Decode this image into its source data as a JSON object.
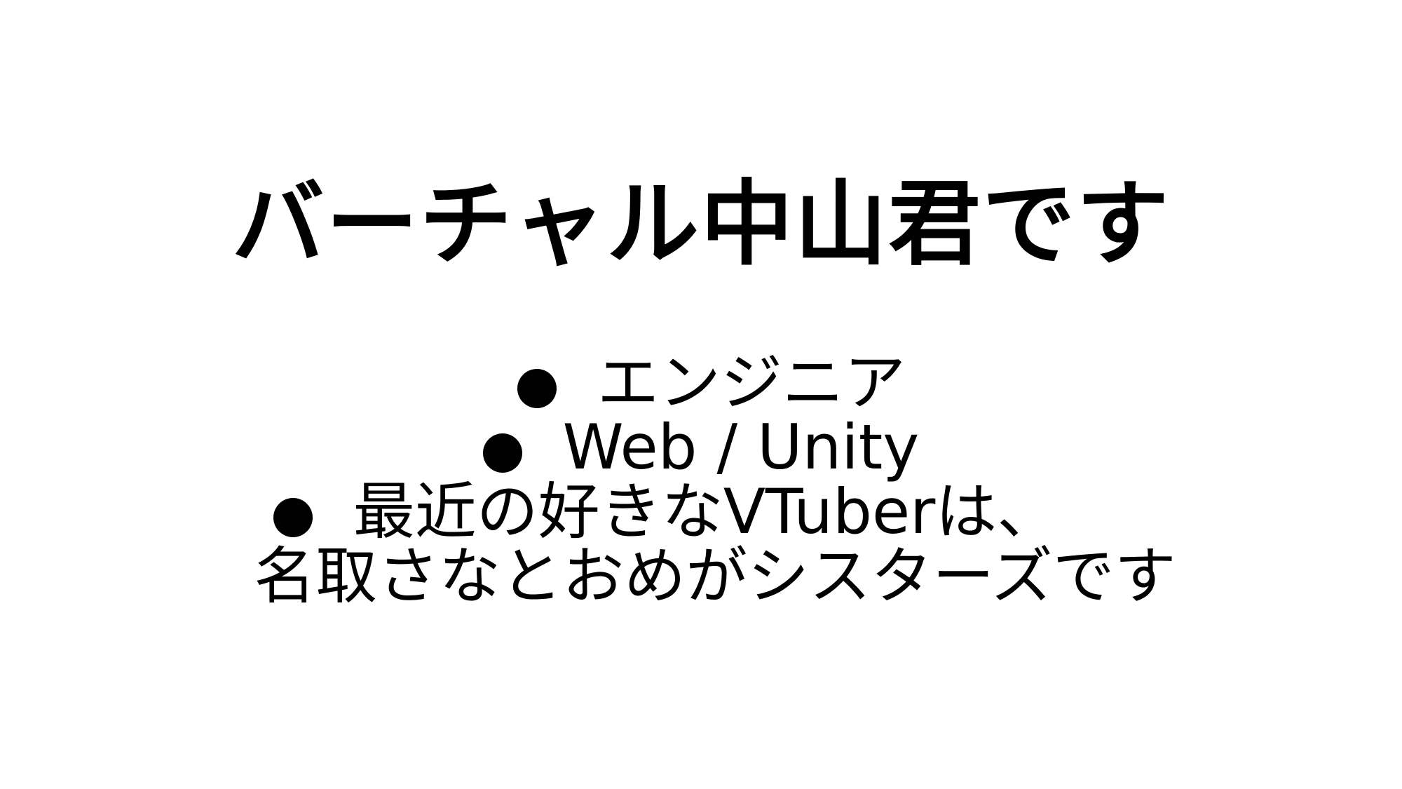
{
  "slide": {
    "title": "バーチャル中山君です",
    "bullets": [
      {
        "text": "エンジニア"
      },
      {
        "text": "Web / Unity"
      },
      {
        "line1": "最近の好きなVTuberは、",
        "line2": "名取さなとおめがシスターズです"
      }
    ]
  }
}
